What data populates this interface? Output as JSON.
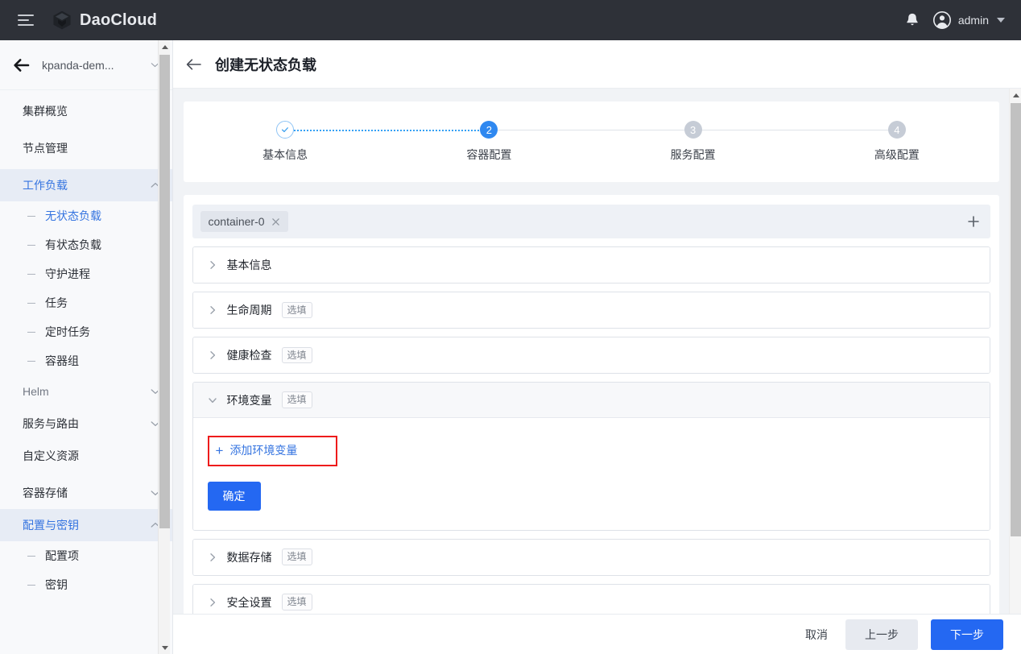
{
  "topbar": {
    "brand": "DaoCloud",
    "menu_icon": "hamburger-icon",
    "notification_icon": "bell-icon",
    "user_name": "admin"
  },
  "sidebar": {
    "cluster_name": "kpanda-dem...",
    "items": [
      {
        "label": "集群概览",
        "type": "item",
        "active": false,
        "expandable": false
      },
      {
        "label": "节点管理",
        "type": "item",
        "active": false,
        "expandable": false
      },
      {
        "label": "工作负载",
        "type": "item",
        "active": true,
        "expandable": true,
        "expanded": true
      },
      {
        "label": "无状态负载",
        "type": "sub",
        "active": true
      },
      {
        "label": "有状态负载",
        "type": "sub",
        "active": false
      },
      {
        "label": "守护进程",
        "type": "sub",
        "active": false
      },
      {
        "label": "任务",
        "type": "sub",
        "active": false
      },
      {
        "label": "定时任务",
        "type": "sub",
        "active": false
      },
      {
        "label": "容器组",
        "type": "sub",
        "active": false
      },
      {
        "label": "Helm",
        "type": "item",
        "active": false,
        "expandable": true,
        "expanded": false,
        "muted": true
      },
      {
        "label": "服务与路由",
        "type": "item",
        "active": false,
        "expandable": true,
        "expanded": false
      },
      {
        "label": "自定义资源",
        "type": "item",
        "active": false,
        "expandable": false
      },
      {
        "label": "容器存储",
        "type": "item",
        "active": false,
        "expandable": true,
        "expanded": false
      },
      {
        "label": "配置与密钥",
        "type": "item",
        "active": true,
        "expandable": true,
        "expanded": true
      },
      {
        "label": "配置项",
        "type": "sub",
        "active": false
      },
      {
        "label": "密钥",
        "type": "sub",
        "active": false
      }
    ]
  },
  "page": {
    "title": "创建无状态负载",
    "back_icon": "back-arrow-icon"
  },
  "stepper": {
    "steps": [
      {
        "number": "1",
        "label": "基本信息",
        "state": "done",
        "glyph": "check-icon"
      },
      {
        "number": "2",
        "label": "容器配置",
        "state": "active"
      },
      {
        "number": "3",
        "label": "服务配置",
        "state": "todo"
      },
      {
        "number": "4",
        "label": "高级配置",
        "state": "todo"
      }
    ],
    "connector_colors": {
      "done": "#35a1f5",
      "todo": "#dfe3e9"
    }
  },
  "containers": {
    "tabs": [
      {
        "label": "container-0",
        "closable": true
      }
    ],
    "add_label": "+"
  },
  "sections": [
    {
      "title": "基本信息",
      "optional": false,
      "expanded": false
    },
    {
      "title": "生命周期",
      "optional": true,
      "expanded": false
    },
    {
      "title": "健康检查",
      "optional": true,
      "expanded": false
    },
    {
      "title": "环境变量",
      "optional": true,
      "expanded": true
    },
    {
      "title": "数据存储",
      "optional": true,
      "expanded": false
    },
    {
      "title": "安全设置",
      "optional": true,
      "expanded": false
    }
  ],
  "optional_tag": "选填",
  "env_panel": {
    "add_label": "添加环境变量",
    "add_icon": "plus-icon",
    "confirm_label": "确定",
    "highlighted": true,
    "highlight_color": "#ee1b1b"
  },
  "footer": {
    "cancel_label": "取消",
    "prev_label": "上一步",
    "next_label": "下一步"
  },
  "colors": {
    "primary": "#2468f2",
    "link": "#3574e0",
    "topbar_bg": "#2e3138",
    "sidebar_bg": "#f8f9fb",
    "content_bg": "#f1f3f6",
    "active_nav_bg": "#e7ecf5"
  }
}
